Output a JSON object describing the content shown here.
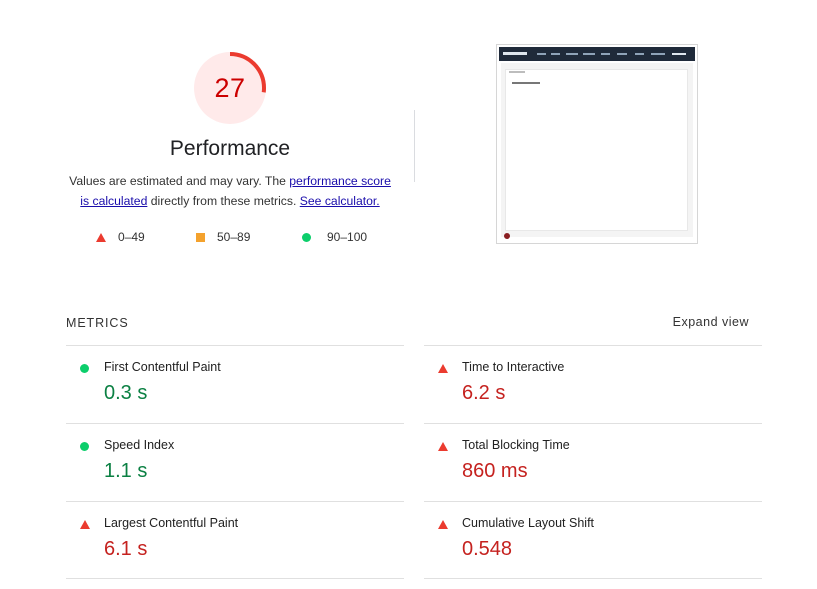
{
  "score": {
    "value": "27",
    "fraction": 0.27,
    "color": "#c00",
    "ring_color": "#eb3b2f",
    "bg_color": "#ffeaea"
  },
  "performance": {
    "title": "Performance",
    "desc_prefix": "Values are estimated and may vary. The ",
    "link_score": "performance score is calculated",
    "desc_mid": " directly from these metrics. ",
    "link_calc": "See calculator."
  },
  "legend": {
    "fail": {
      "label": "0–49",
      "icon": "triangle-icon",
      "color": "#eb3b2f"
    },
    "average": {
      "label": "50–89",
      "icon": "square-icon",
      "color": "#f4a22d"
    },
    "pass": {
      "label": "90–100",
      "icon": "circle-icon",
      "color": "#0cce6b"
    }
  },
  "metrics": {
    "header": "METRICS",
    "expand_label": "Expand view",
    "items": [
      {
        "label": "First Contentful Paint",
        "value": "0.3 s",
        "status": "pass"
      },
      {
        "label": "Time to Interactive",
        "value": "6.2 s",
        "status": "fail"
      },
      {
        "label": "Speed Index",
        "value": "1.1 s",
        "status": "pass"
      },
      {
        "label": "Total Blocking Time",
        "value": "860 ms",
        "status": "fail"
      },
      {
        "label": "Largest Contentful Paint",
        "value": "6.1 s",
        "status": "fail"
      },
      {
        "label": "Cumulative Layout Shift",
        "value": "0.548",
        "status": "fail"
      }
    ]
  }
}
